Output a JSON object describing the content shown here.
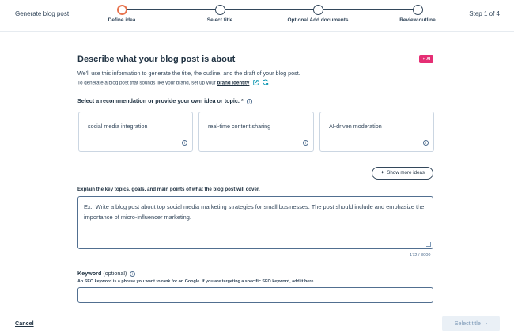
{
  "header": {
    "title": "Generate blog post",
    "step_count": "Step 1 of 4",
    "steps": [
      {
        "label": "Define idea",
        "state": "active"
      },
      {
        "label": "Select title",
        "state": "pending"
      },
      {
        "label": "Optional Add documents",
        "state": "pending"
      },
      {
        "label": "Review outline",
        "state": "pending"
      }
    ]
  },
  "main": {
    "title": "Describe what your blog post is about",
    "ai_badge": "✦ AI",
    "intro": "We'll use this information to generate the title, the outline, and the draft of your blog post.",
    "brand_prefix": "To generate a blog post that sounds like your brand, set up your ",
    "brand_link": "brand identity",
    "recommendation_label": "Select a recommendation or provide your own idea or topic. *",
    "recommendations": [
      {
        "text": "social media integration"
      },
      {
        "text": "real-time content sharing"
      },
      {
        "text": "AI-driven moderation"
      }
    ],
    "show_more": "Show more ideas",
    "explain_label": "Explain the key topics, goals, and main points of what the blog post will cover.",
    "explain_placeholder": "Ex., Write a blog post about top social media marketing strategies for small businesses. The post should include and emphasize the importance of micro-influencer marketing.",
    "counter": "172 / 3000",
    "keyword_label": "Keyword",
    "keyword_optional": " (optional)",
    "keyword_help": "An SEO keyword is a phrase you want to rank for on Google. If you are targeting a specific SEO keyword, add it here.",
    "keyword_value": ""
  },
  "footer": {
    "cancel": "Cancel",
    "next": "Select title",
    "next_chevron": "›"
  },
  "colors": {
    "accent_orange": "#e8744f",
    "ai_pink": "#e52e74",
    "text_dark": "#213343",
    "border": "#cbd6e2"
  }
}
